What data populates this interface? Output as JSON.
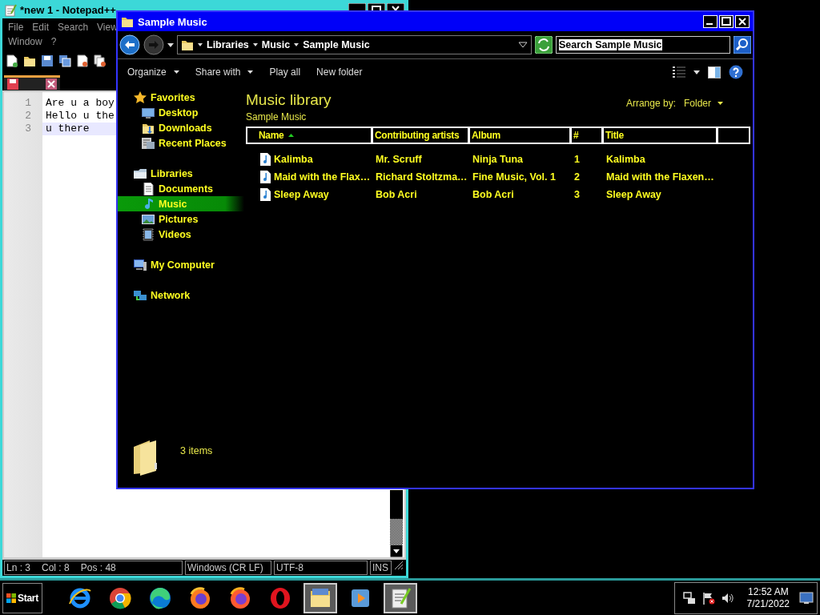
{
  "notepad": {
    "title": "*new 1 - Notepad++",
    "menu_rows": [
      [
        "File",
        "Edit",
        "Search",
        "View"
      ],
      [
        "Window",
        "?"
      ]
    ],
    "lines": [
      {
        "number": "1",
        "text": "Are u a boy",
        "current": false
      },
      {
        "number": "2",
        "text": "Hello u the",
        "current": false
      },
      {
        "number": "3",
        "text": "u there",
        "current": true
      }
    ],
    "status": {
      "position": [
        "Ln : 3",
        "Col : 8",
        "Pos : 48"
      ],
      "eol": "Windows (CR LF)",
      "encoding": "UTF-8",
      "mode": "INS"
    }
  },
  "explorer": {
    "title": "Sample Music",
    "breadcrumb": [
      "Libraries",
      "Music",
      "Sample Music"
    ],
    "search": {
      "value": "Search Sample Music",
      "highlighted": true
    },
    "toolbar": [
      {
        "label": "Organize",
        "menu": true
      },
      {
        "label": "Share with",
        "menu": true
      },
      {
        "label": "Play all",
        "menu": false
      },
      {
        "label": "New folder",
        "menu": false
      }
    ],
    "nav": [
      {
        "label": "Favorites",
        "selected": false,
        "children": [
          {
            "label": "Desktop",
            "selected": false
          },
          {
            "label": "Downloads",
            "selected": false
          },
          {
            "label": "Recent Places",
            "selected": false
          }
        ]
      },
      {
        "label": "Libraries",
        "selected": false,
        "children": [
          {
            "label": "Documents",
            "selected": false
          },
          {
            "label": "Music",
            "selected": true
          },
          {
            "label": "Pictures",
            "selected": false
          },
          {
            "label": "Videos",
            "selected": false
          }
        ]
      },
      {
        "label": "My Computer",
        "selected": false
      },
      {
        "label": "Network",
        "selected": false
      }
    ],
    "heading": "Music library",
    "subheading": "Sample Music",
    "arrange_label": "Arrange by:",
    "arrange_value": "Folder",
    "columns": [
      {
        "label": "Name",
        "sorted": true
      },
      {
        "label": "Contributing artists",
        "sorted": false
      },
      {
        "label": "Album",
        "sorted": false
      },
      {
        "label": "#",
        "sorted": false
      },
      {
        "label": "Title",
        "sorted": false
      }
    ],
    "rows": [
      [
        "Kalimba",
        "Mr. Scruff",
        "Ninja Tuna",
        "1",
        "Kalimba"
      ],
      [
        "Maid with the Flax…",
        "Richard Stoltzma…",
        "Fine Music, Vol. 1",
        "2",
        "Maid with the Flaxen…"
      ],
      [
        "Sleep Away",
        "Bob Acri",
        "Bob Acri",
        "3",
        "Sleep Away"
      ]
    ],
    "item_count": "3 items"
  },
  "taskbar": {
    "start": "Start",
    "apps": [
      {
        "selected": false
      },
      {
        "selected": false
      },
      {
        "selected": false
      },
      {
        "selected": false
      },
      {
        "selected": false
      },
      {
        "selected": false
      },
      {
        "selected": true
      },
      {
        "selected": false
      },
      {
        "selected": true
      }
    ],
    "time": "12:52 AM",
    "date": "7/21/2022"
  }
}
